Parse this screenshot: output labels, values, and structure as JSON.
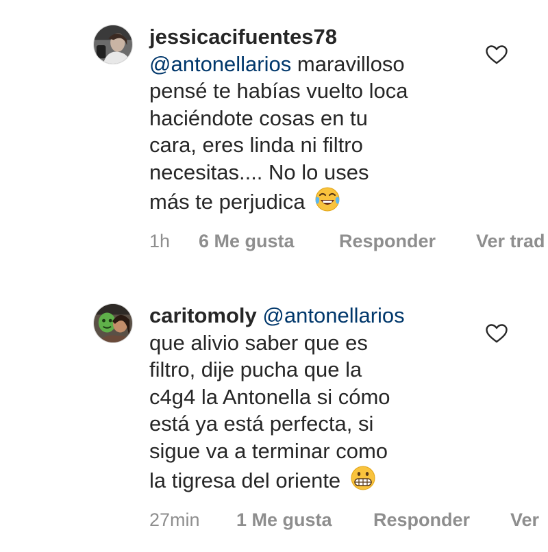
{
  "comments": [
    {
      "username": "jessicacifuentes78",
      "mention": "@antonellarios",
      "first_line_rest": " maravilloso",
      "lines": [
        "pensé te habías vuelto loca",
        "haciéndote cosas en tu",
        "cara, eres linda ni filtro",
        "necesitas.... No lo uses",
        "más te perjudica"
      ],
      "emoji": "face-with-tears-of-joy",
      "time": "1h",
      "likes": "6 Me gusta",
      "reply": "Responder",
      "view_translation": "Ver trad"
    },
    {
      "username": "caritomoly",
      "mention": "@antonellarios",
      "lines": [
        "que alivio saber que es",
        "filtro, dije pucha que la",
        "c4g4 la Antonella si cómo",
        "está ya está perfecta, si",
        "sigue va a terminar como",
        "la tigresa del oriente"
      ],
      "emoji": "grimacing-face",
      "time": "27min",
      "likes": "1 Me gusta",
      "reply": "Responder",
      "view_translation": "Ver"
    }
  ],
  "colors": {
    "text": "#262626",
    "mention": "#00376b",
    "meta": "#8e8e8e",
    "background": "#ffffff"
  }
}
